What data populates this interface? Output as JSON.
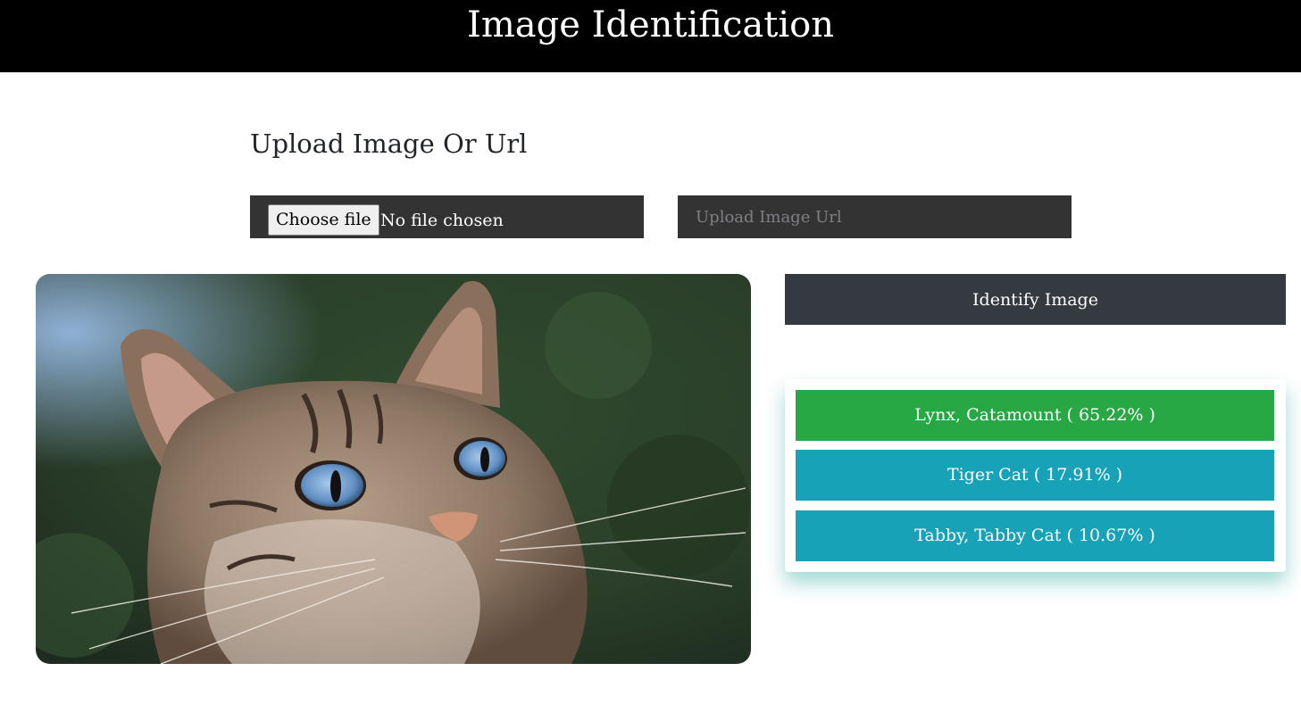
{
  "header": {
    "title": "Image Identification"
  },
  "upload": {
    "title": "Upload Image Or Url",
    "choose_file_label": "Choose file",
    "file_status": "No file chosen",
    "url_placeholder": "Upload Image Url"
  },
  "preview": {
    "image": "tabby-cat-photo"
  },
  "actions": {
    "identify_label": "Identify Image"
  },
  "results": [
    {
      "label": "Lynx, Catamount ( 65.22% )",
      "color": "#28a745"
    },
    {
      "label": "Tiger Cat ( 17.91% )",
      "color": "#17a2b8"
    },
    {
      "label": "Tabby, Tabby Cat ( 10.67% )",
      "color": "#17a2b8"
    }
  ],
  "colors": {
    "header_bg": "#000000",
    "input_bg": "#333333",
    "button_bg": "#343a40",
    "top_result": "#28a745",
    "other_result": "#17a2b8"
  }
}
